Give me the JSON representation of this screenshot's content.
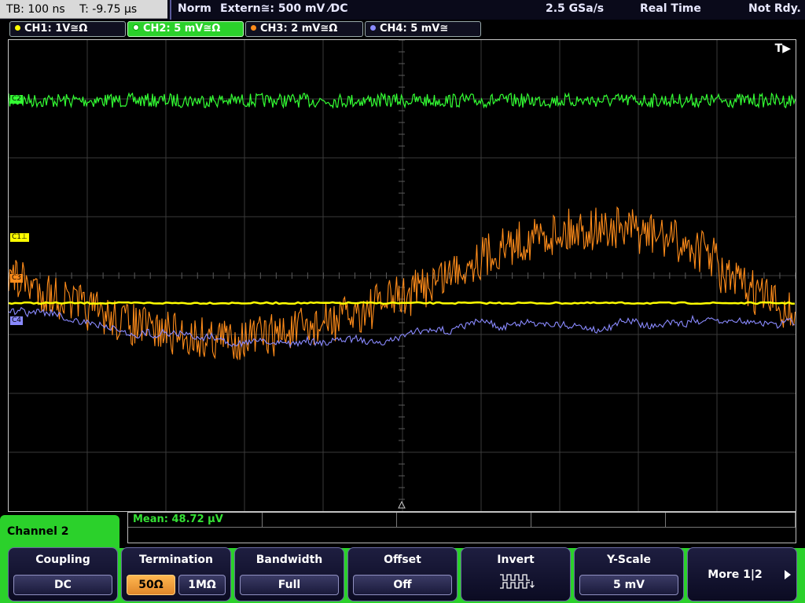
{
  "status": {
    "timebase": "TB: 100 ns",
    "trigger_pos": "T: -9.75 µs",
    "mode": "Norm",
    "trigger_source": "Extern≅: 500 mV ⁄DC",
    "sample_rate": "2.5 GSa/s",
    "acq_mode": "Real Time",
    "state": "Not Rdy."
  },
  "channels": [
    {
      "label": "CH1: 1V≅Ω",
      "color": "#ffff00",
      "active": false
    },
    {
      "label": "CH2: 5 mV≅Ω",
      "color": "#33ff33",
      "active": true
    },
    {
      "label": "CH3: 2 mV≅Ω",
      "color": "#ff8c1a",
      "active": false
    },
    {
      "label": "CH4: 5 mV≅",
      "color": "#8a8aff",
      "active": false
    }
  ],
  "markers": {
    "trigger": "T▶",
    "ch1": "C1⊥",
    "ch2": "C2",
    "ch3": "C3",
    "ch4": "C4"
  },
  "measurement": {
    "mean": "Mean: 48.72 µV"
  },
  "menu": {
    "title": "Channel 2",
    "coupling": {
      "label": "Coupling",
      "value": "DC"
    },
    "termination": {
      "label": "Termination",
      "option_a": "50Ω",
      "option_b": "1MΩ"
    },
    "bandwidth": {
      "label": "Bandwidth",
      "value": "Full"
    },
    "offset": {
      "label": "Offset",
      "value": "Off"
    },
    "invert": {
      "label": "Invert"
    },
    "yscale": {
      "label": "Y-Scale",
      "value": "5 mV"
    },
    "more": {
      "label": "More 1|2"
    }
  }
}
